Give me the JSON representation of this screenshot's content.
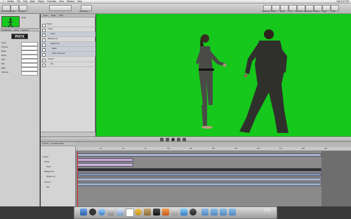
{
  "menubar": {
    "items": [
      "Motion",
      "File",
      "Edit",
      "Mark",
      "Object",
      "Favorites",
      "View",
      "Window",
      "Help"
    ],
    "clock": "Sat 9:12 PM"
  },
  "toolbar": {
    "labels": [
      "File Browser",
      "Library",
      "Inspector",
      "Recording",
      "Behaviors",
      "Filters",
      "Mask",
      "Text",
      "Particles",
      "Replicator",
      "Shapes",
      "Layer",
      "HUD"
    ]
  },
  "left_panel": {
    "tabs": [
      "File Browser",
      "Library",
      "Inspector"
    ],
    "thumb_title": "Ninjas",
    "plugin_badge": "PHYX",
    "params": [
      "Keyer",
      "Preview",
      "Matte",
      "Erode",
      "Spill",
      "Blur",
      "Edge",
      "Softness"
    ]
  },
  "layers_panel": {
    "tabs": [
      "Layers",
      "Media",
      "Audio"
    ],
    "rows": [
      "Project",
      "Group",
      "Keyer",
      "Background",
      "Ninjas.mov",
      "Matte",
      "Color Correction",
      "Group 1",
      "Sky"
    ]
  },
  "timeline": {
    "tabs": [
      "Timeline",
      "Keyframe Editor",
      "Audio Editor"
    ],
    "tracks": [
      "Project",
      "Group",
      "Keyer",
      "Background",
      "Ninjas.mov",
      "Group 1",
      "Sky"
    ],
    "ruler": [
      "1",
      "31",
      "61",
      "91",
      "121",
      "151",
      "181",
      "211",
      "241",
      "271",
      "301",
      "331"
    ]
  },
  "colors": {
    "greenscreen": "#15c81b",
    "accent": "#5a78a8"
  }
}
